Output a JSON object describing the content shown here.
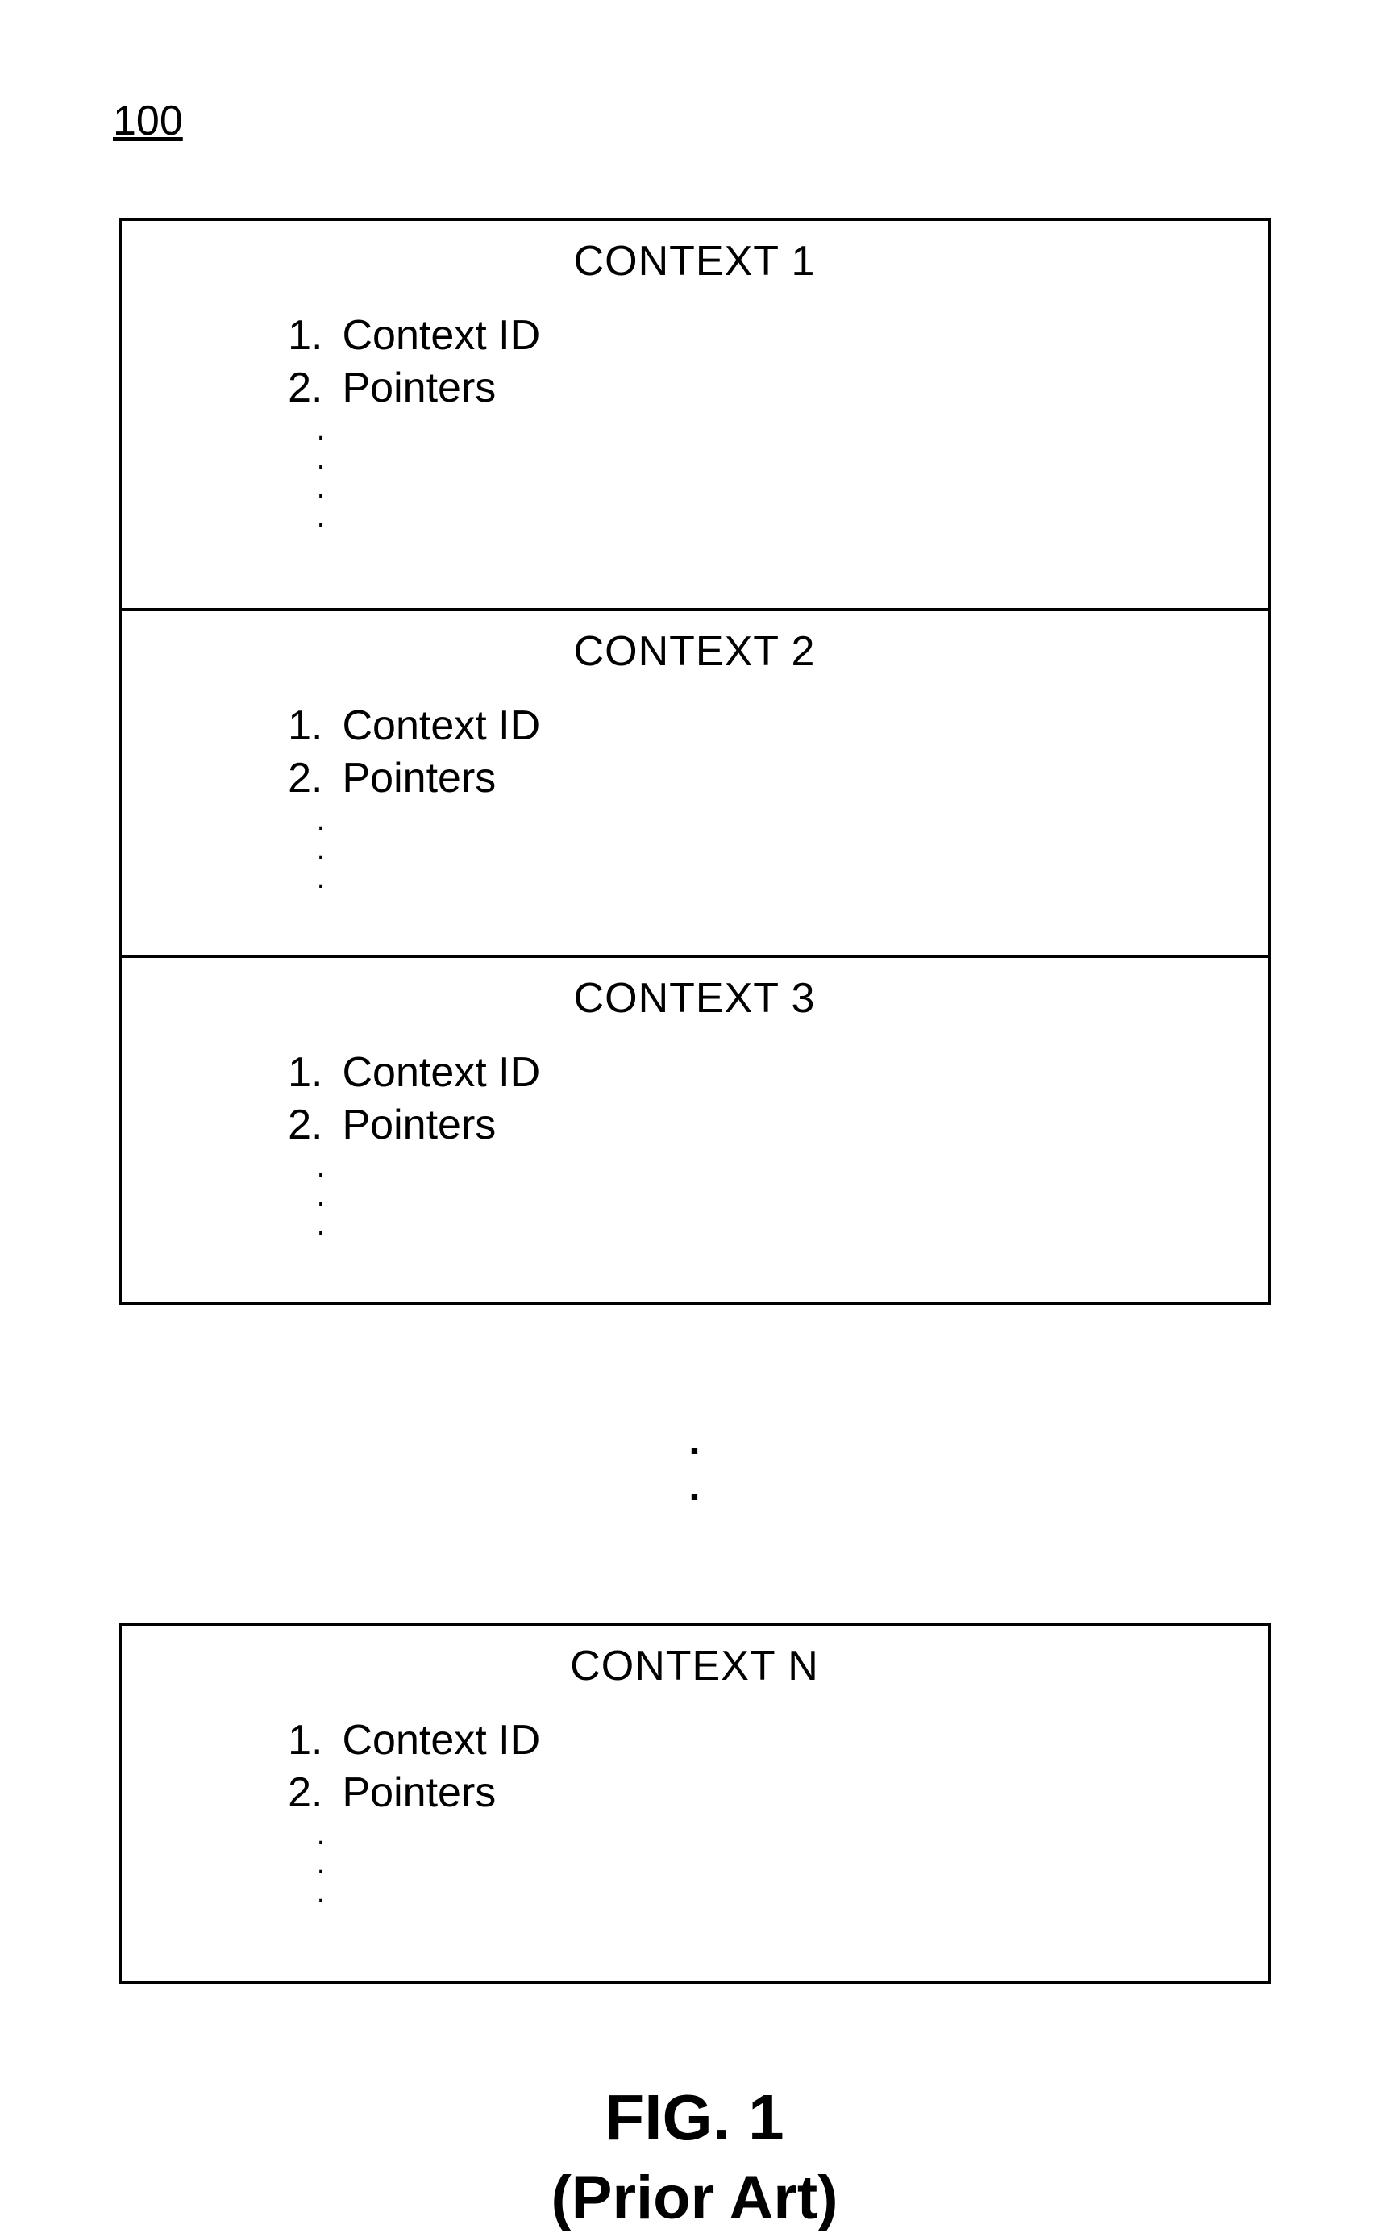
{
  "ref_number": "100",
  "contexts_stacked": [
    {
      "title": "CONTEXT 1",
      "items": [
        {
          "n": "1.",
          "label": "Context ID"
        },
        {
          "n": "2.",
          "label": "Pointers"
        }
      ]
    },
    {
      "title": "CONTEXT 2",
      "items": [
        {
          "n": "1.",
          "label": "Context ID"
        },
        {
          "n": "2.",
          "label": "Pointers"
        }
      ]
    },
    {
      "title": "CONTEXT 3",
      "items": [
        {
          "n": "1.",
          "label": "Context ID"
        },
        {
          "n": "2.",
          "label": "Pointers"
        }
      ]
    }
  ],
  "context_last": {
    "title": "CONTEXT N",
    "items": [
      {
        "n": "1.",
        "label": "Context ID"
      },
      {
        "n": "2.",
        "label": "Pointers"
      }
    ]
  },
  "ellipsis_block": "⋮",
  "gap_dots_line1": ".",
  "gap_dots_line2": ".",
  "figure_label": "FIG. 1",
  "figure_subtitle": "(Prior Art)"
}
